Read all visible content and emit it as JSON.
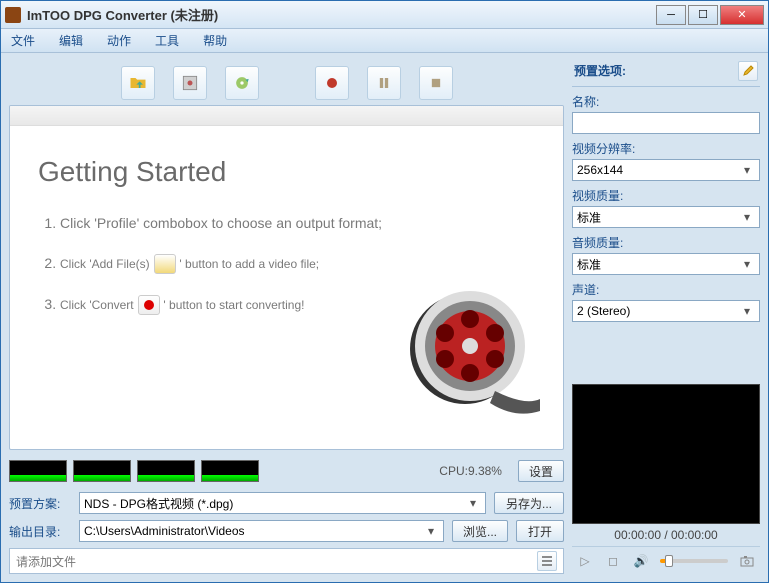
{
  "title": "ImTOO DPG Converter (未注册)",
  "menu": {
    "file": "文件",
    "edit": "编辑",
    "action": "动作",
    "tool": "工具",
    "help": "帮助"
  },
  "toolbar": {
    "addfile": "add-file",
    "addprofile": "add-profile",
    "settings": "settings",
    "record": "record",
    "pause": "pause",
    "stop": "stop"
  },
  "getting_started": {
    "heading": "Getting Started",
    "step1_a": "Click 'Profile' combobox to choose an output format;",
    "step2_a": "Click 'Add File(s)",
    "step2_b": "' button to add a video file;",
    "step3_a": "Click 'Convert",
    "step3_b": "' button to start converting!"
  },
  "cpu": {
    "label": "CPU:",
    "value": "9.38%",
    "settings_btn": "设置"
  },
  "profile": {
    "label": "预置方案:",
    "value": "NDS - DPG格式视频 (*.dpg)",
    "saveas": "另存为..."
  },
  "output": {
    "label": "输出目录:",
    "value": "C:\\Users\\Administrator\\Videos",
    "browse": "浏览...",
    "open": "打开"
  },
  "status": {
    "text": "请添加文件"
  },
  "preset": {
    "header": "预置选项:",
    "name": {
      "label": "名称:",
      "value": ""
    },
    "resolution": {
      "label": "视频分辨率:",
      "value": "256x144"
    },
    "vquality": {
      "label": "视频质量:",
      "value": "标准"
    },
    "aquality": {
      "label": "音频质量:",
      "value": "标准"
    },
    "channel": {
      "label": "声道:",
      "value": "2 (Stereo)"
    }
  },
  "time": "00:00:00 / 00:00:00"
}
